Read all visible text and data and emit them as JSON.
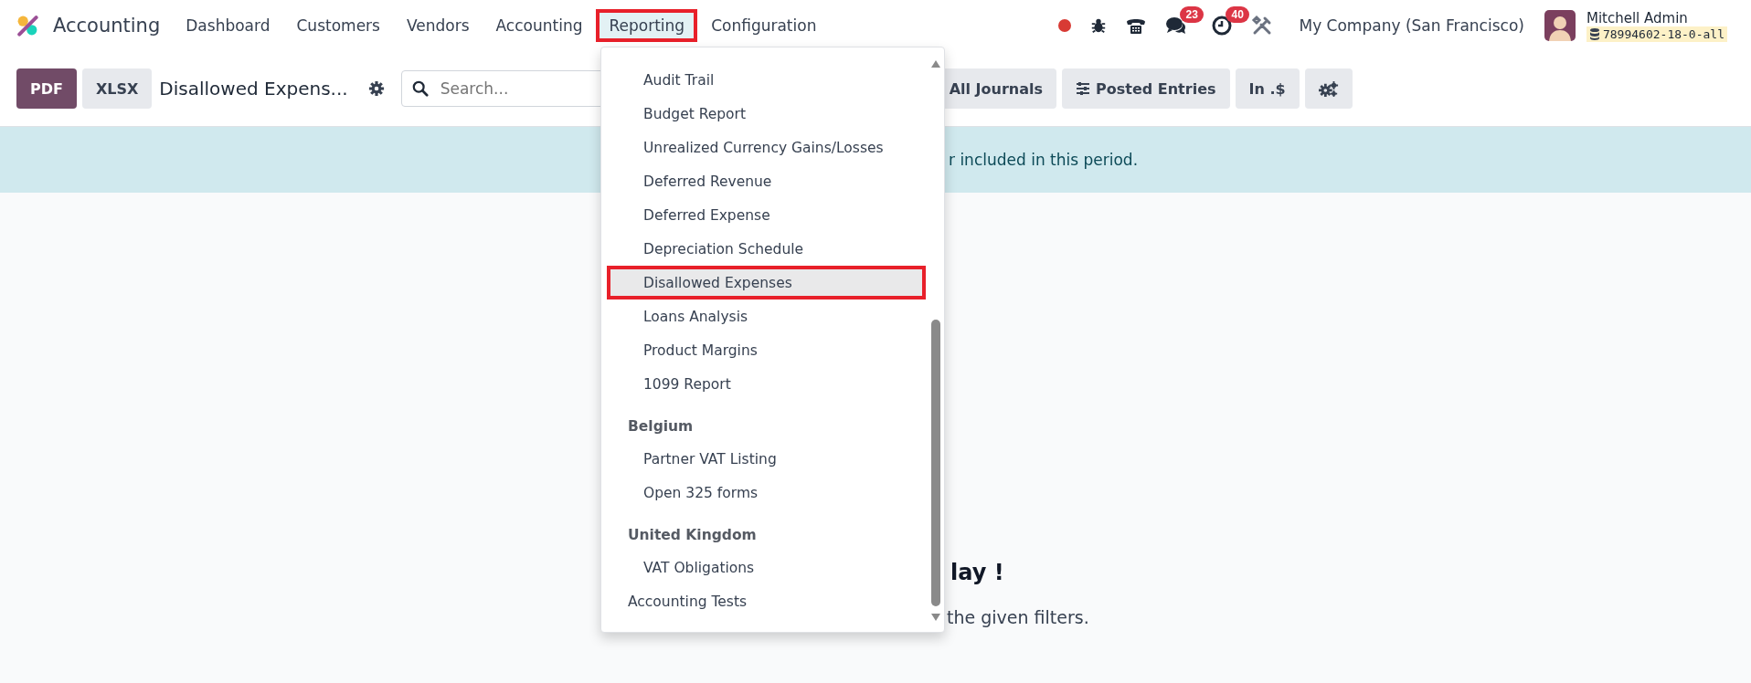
{
  "navbar": {
    "app_name": "Accounting",
    "menu": [
      {
        "label": "Dashboard",
        "selected": false,
        "highlighted": false
      },
      {
        "label": "Customers",
        "selected": false,
        "highlighted": false
      },
      {
        "label": "Vendors",
        "selected": false,
        "highlighted": false
      },
      {
        "label": "Accounting",
        "selected": false,
        "highlighted": false
      },
      {
        "label": "Reporting",
        "selected": true,
        "highlighted": true
      },
      {
        "label": "Configuration",
        "selected": false,
        "highlighted": false
      }
    ],
    "messages_badge": "23",
    "activities_badge": "40",
    "company": "My Company (San Francisco)",
    "user": {
      "name": "Mitchell Admin",
      "database": "78994602-18-0-all"
    }
  },
  "control_bar": {
    "export_buttons": [
      "PDF",
      "XLSX"
    ],
    "title": "Disallowed Expens...",
    "search": {
      "placeholder": "Search..."
    },
    "filters": [
      {
        "label": "All Journals",
        "kind": "plain"
      },
      {
        "label": "Posted Entries",
        "kind": "sliders"
      },
      {
        "label": "In .$",
        "kind": "plain"
      }
    ]
  },
  "banner": {
    "text": "r included in this period."
  },
  "empty_state": {
    "title": "lay !",
    "message": "the given filters."
  },
  "dropdown": {
    "entries": [
      {
        "kind": "group",
        "children": [
          {
            "label": "Audit Trail",
            "selected": false,
            "highlighted": false
          },
          {
            "label": "Budget Report",
            "selected": false,
            "highlighted": false
          },
          {
            "label": "Unrealized Currency Gains/Losses",
            "selected": false,
            "highlighted": false
          },
          {
            "label": "Deferred Revenue",
            "selected": false,
            "highlighted": false
          },
          {
            "label": "Deferred Expense",
            "selected": false,
            "highlighted": false
          },
          {
            "label": "Depreciation Schedule",
            "selected": false,
            "highlighted": false
          },
          {
            "label": "Disallowed Expenses",
            "selected": true,
            "highlighted": true
          },
          {
            "label": "Loans Analysis",
            "selected": false,
            "highlighted": false
          },
          {
            "label": "Product Margins",
            "selected": false,
            "highlighted": false
          },
          {
            "label": "1099 Report",
            "selected": false,
            "highlighted": false
          }
        ]
      },
      {
        "kind": "group",
        "label": "Belgium",
        "children": [
          {
            "label": "Partner VAT Listing",
            "selected": false,
            "highlighted": false
          },
          {
            "label": "Open 325 forms",
            "selected": false,
            "highlighted": false
          }
        ]
      },
      {
        "kind": "group",
        "label": "United Kingdom",
        "children": [
          {
            "label": "VAT Obligations",
            "selected": false,
            "highlighted": false
          }
        ]
      },
      {
        "kind": "item",
        "label": "Accounting Tests",
        "selected": false,
        "highlighted": false
      }
    ]
  }
}
